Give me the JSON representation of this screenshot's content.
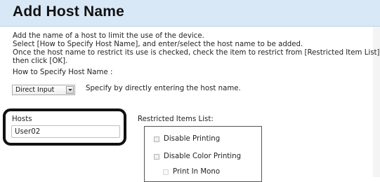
{
  "title": "Add Host Name",
  "description": [
    "Add the name of a host to limit the use of the device.",
    "Select [How to Specify Host Name], and enter/select the host name to be added.",
    "Once the host name to restrict its use is checked, check the item to restrict from [Restricted Item List], and",
    "then click [OK]."
  ],
  "specify": {
    "label": "How to Specify Host Name :",
    "selected": "Direct Input",
    "hint": "Specify by directly entering the host name."
  },
  "hosts": {
    "label": "Hosts",
    "value": "User02"
  },
  "restricted": {
    "label": "Restricted Items List:",
    "items": [
      {
        "label": "Disable Printing",
        "checked": false,
        "enabled": true
      },
      {
        "label": "Disable Color Printing",
        "checked": false,
        "enabled": true
      },
      {
        "label": "Print In Mono",
        "checked": false,
        "enabled": false
      }
    ]
  }
}
